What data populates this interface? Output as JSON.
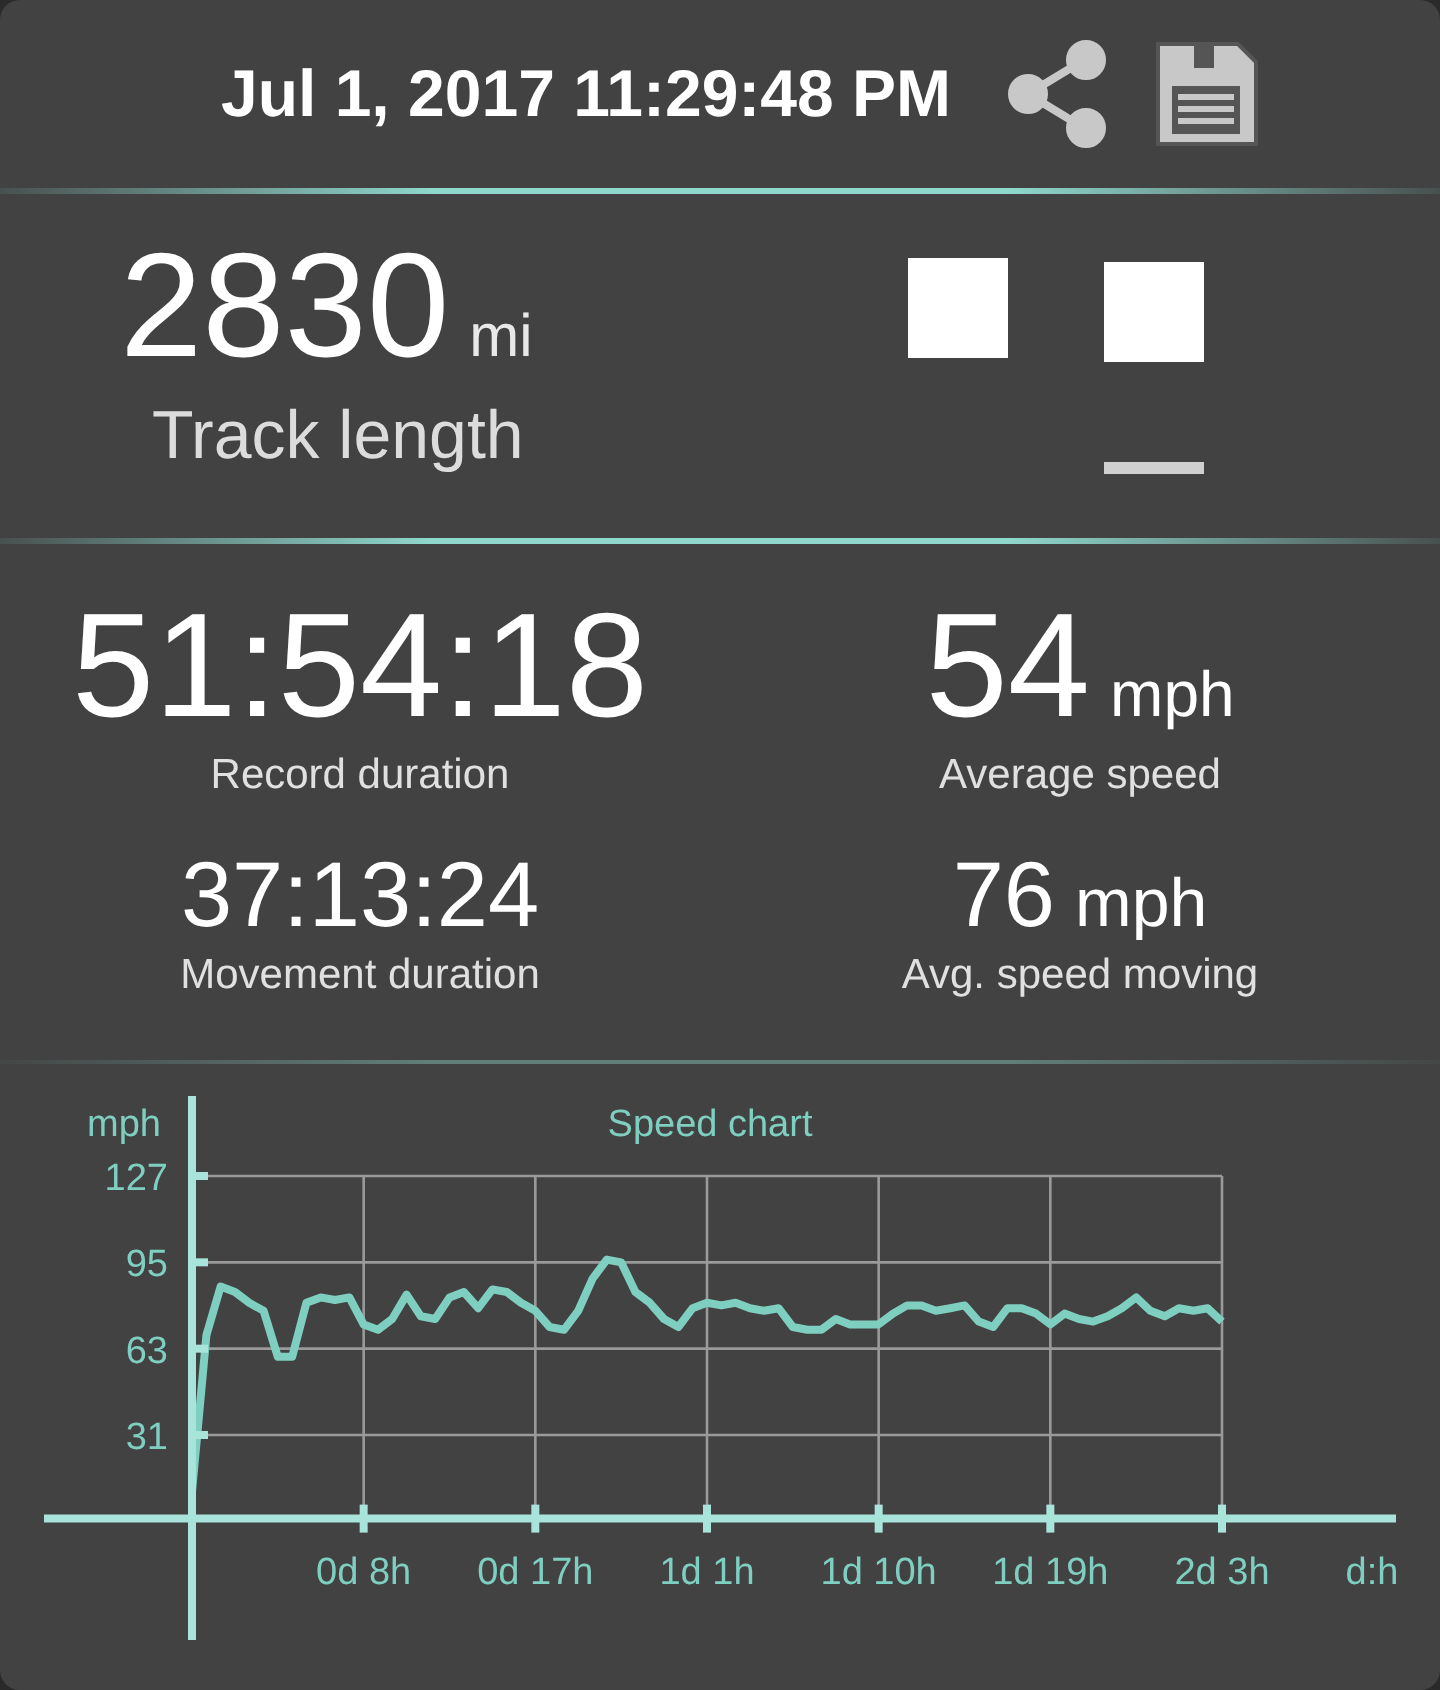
{
  "header": {
    "title": "Jul 1, 2017 11:29:48 PM"
  },
  "track": {
    "value": "2830",
    "unit": "mi",
    "label": "Track length"
  },
  "stats": {
    "primary": [
      {
        "value": "51:54:18",
        "label": "Record duration"
      },
      {
        "value": "54",
        "unit": "mph",
        "label": "Average speed"
      }
    ],
    "secondary": [
      {
        "value": "37:13:24",
        "label": "Movement duration"
      },
      {
        "value": "76",
        "unit": "mph",
        "label": "Avg. speed moving"
      }
    ]
  },
  "chart": {
    "chart_data": {
      "type": "line",
      "title": "Speed chart",
      "xlabel": "d:h",
      "ylabel": "mph",
      "ylim": [
        -45,
        127
      ],
      "grid": true,
      "yticks": [
        31,
        63,
        95,
        127
      ],
      "categories": [
        null,
        null,
        null,
        null,
        null,
        null,
        null,
        null,
        null,
        null,
        null,
        null,
        "0d 8h",
        null,
        null,
        null,
        null,
        null,
        null,
        null,
        null,
        null,
        null,
        null,
        "0d 17h",
        null,
        null,
        null,
        null,
        null,
        null,
        null,
        null,
        null,
        null,
        null,
        "1d 1h",
        null,
        null,
        null,
        null,
        null,
        null,
        null,
        null,
        null,
        null,
        null,
        "1d 10h",
        null,
        null,
        null,
        null,
        null,
        null,
        null,
        null,
        null,
        null,
        null,
        "1d 19h",
        null,
        null,
        null,
        null,
        null,
        null,
        null,
        null,
        null,
        null,
        null,
        "2d 3h"
      ],
      "series": [
        {
          "color": "#7fcfc0",
          "values": [
            10,
            68,
            86,
            84,
            80,
            77,
            60,
            60,
            80,
            82,
            81,
            82,
            72,
            70,
            74,
            83,
            75,
            74,
            82,
            84,
            78,
            85,
            84,
            80,
            77,
            71,
            70,
            77,
            89,
            96,
            95,
            84,
            80,
            74,
            71,
            78,
            80,
            79,
            80,
            78,
            77,
            78,
            71,
            70,
            70,
            74,
            72,
            72,
            72,
            76,
            79,
            79,
            77,
            78,
            79,
            73,
            71,
            78,
            78,
            76,
            72,
            76,
            74,
            73,
            75,
            78,
            82,
            77,
            75,
            78,
            77,
            78,
            73
          ]
        }
      ]
    }
  }
}
